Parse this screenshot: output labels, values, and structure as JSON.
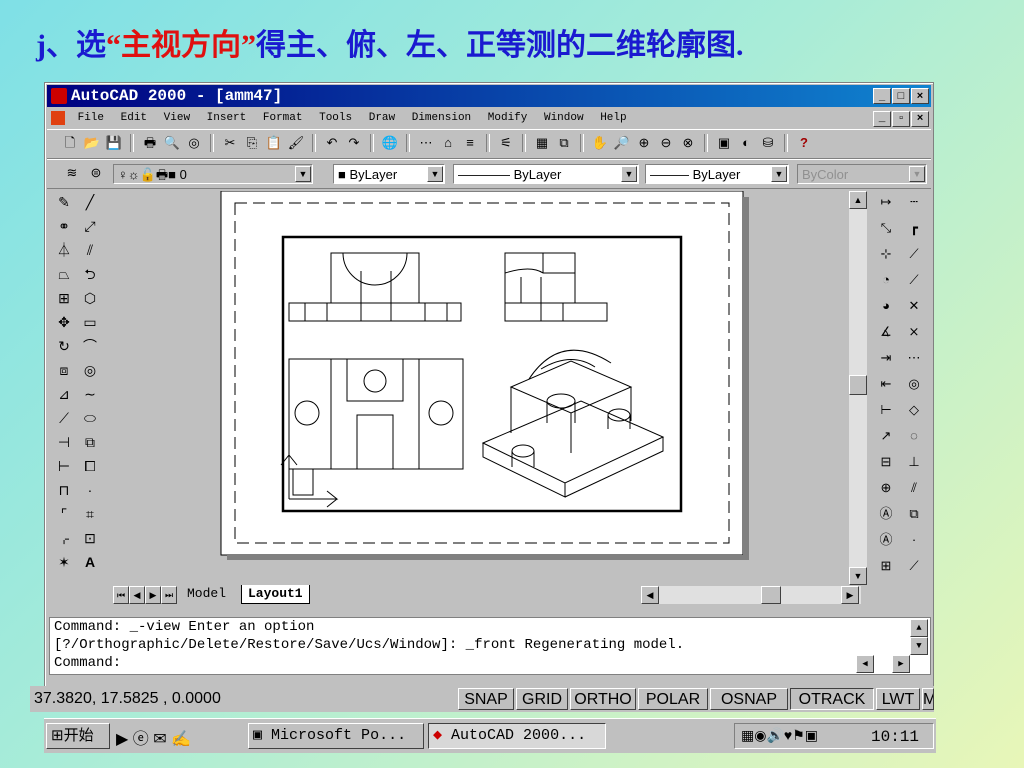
{
  "slide": {
    "title_prefix": "j、选",
    "title_highlight": "“主视方向”",
    "title_suffix": "得主、俯、左、正等测的二维轮廓图."
  },
  "window": {
    "title": "AutoCAD 2000 - [amm47]"
  },
  "menu": [
    "File",
    "Edit",
    "View",
    "Insert",
    "Format",
    "Tools",
    "Draw",
    "Dimension",
    "Modify",
    "Window",
    "Help"
  ],
  "layers": {
    "layer": "0",
    "color": "ByLayer",
    "linetype": "ByLayer",
    "lineweight": "ByLayer",
    "plotstyle": "ByColor"
  },
  "tabs": {
    "model": "Model",
    "layout": "Layout1"
  },
  "command": {
    "line1": "Command: _-view Enter an option",
    "line2": "[?/Orthographic/Delete/Restore/Save/Ucs/Window]: _front Regenerating model.",
    "line3": "Command:"
  },
  "status": {
    "coords": "37.3820,  17.5825 , 0.0000",
    "buttons": [
      "SNAP",
      "GRID",
      "ORTHO",
      "POLAR",
      "OSNAP",
      "OTRACK",
      "LWT",
      "M"
    ]
  },
  "taskbar": {
    "start": "开始",
    "task1": "Microsoft Po...",
    "task2": "AutoCAD 2000...",
    "clock": "10:11"
  }
}
